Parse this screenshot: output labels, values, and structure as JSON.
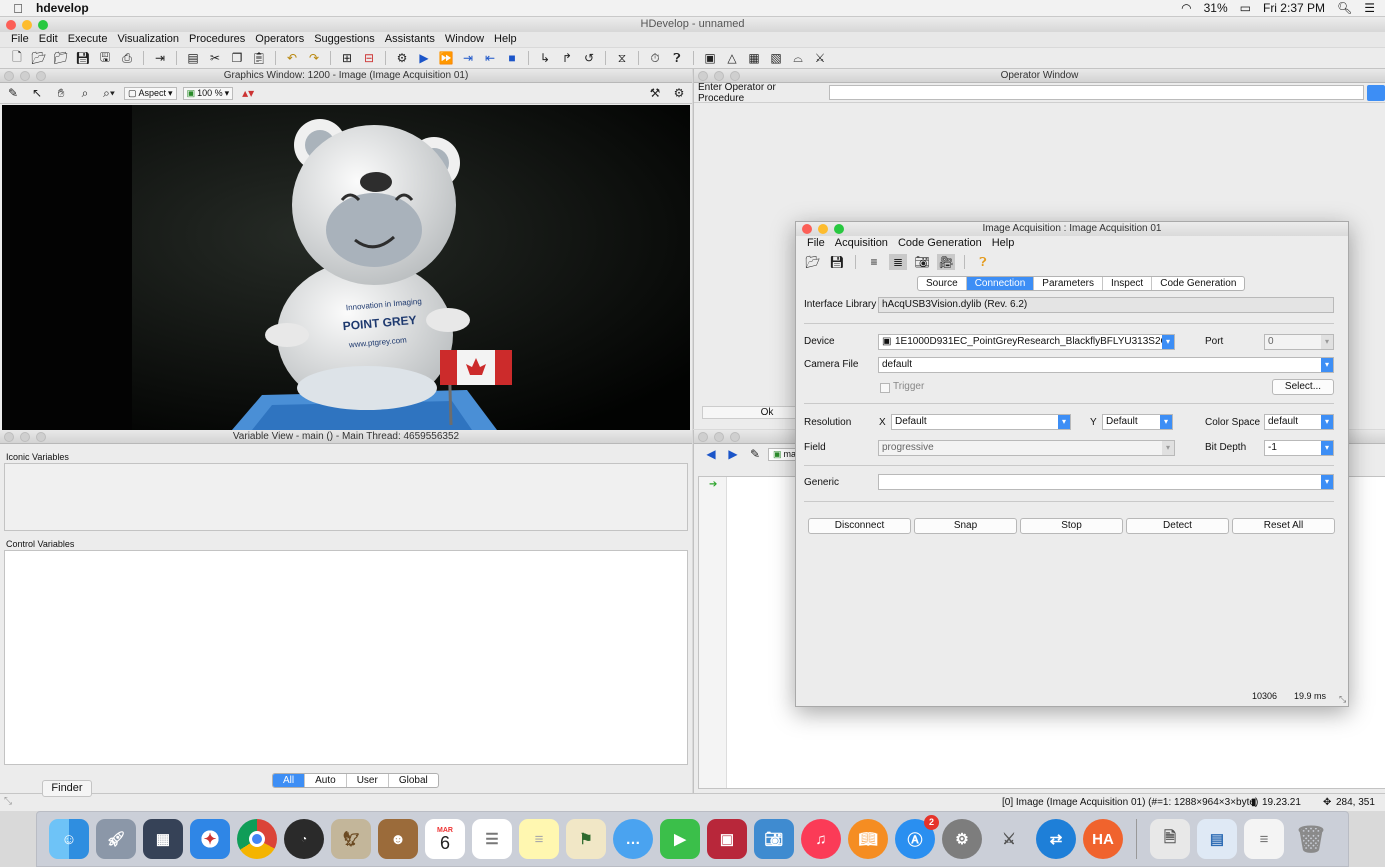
{
  "system_menubar": {
    "app_name": "hdevelop",
    "battery": "31%",
    "clock": "Fri 2:37 PM"
  },
  "app": {
    "title": "HDevelop - unnamed",
    "menu": [
      "File",
      "Edit",
      "Execute",
      "Visualization",
      "Procedures",
      "Operators",
      "Suggestions",
      "Assistants",
      "Window",
      "Help"
    ]
  },
  "graphics_window": {
    "title": "Graphics Window: 1200 - Image (Image Acquisition 01)",
    "aspect_label": "Aspect",
    "zoom_label": "100 %",
    "image_text": {
      "line1": "Innovation in Imaging",
      "brand": "POINT GREY",
      "url": "www.ptgrey.com"
    }
  },
  "operator_window": {
    "title": "Operator Window",
    "prompt_label": "Enter Operator or Procedure",
    "ok_label": "Ok"
  },
  "variable_view": {
    "title": "Variable View - main () - Main Thread: 4659556352",
    "iconic_label": "Iconic Variables",
    "control_label": "Control Variables",
    "filters": [
      "All",
      "Auto",
      "User",
      "Global"
    ]
  },
  "program_window": {
    "procedure": "main"
  },
  "acquisition_dialog": {
    "title": "Image Acquisition : Image Acquisition 01",
    "menu": [
      "File",
      "Acquisition",
      "Code Generation",
      "Help"
    ],
    "tabs": [
      "Source",
      "Connection",
      "Parameters",
      "Inspect",
      "Code Generation"
    ],
    "active_tab": "Connection",
    "interface_library_label": "Interface Library",
    "interface_library_value": "hAcqUSB3Vision.dylib (Rev. 6.2)",
    "device_label": "Device",
    "device_value": "1E1000D931EC_PointGreyResearch_BlackflyBFLYU313S2C",
    "port_label": "Port",
    "port_value": "0",
    "camera_file_label": "Camera File",
    "camera_file_value": "default",
    "trigger_label": "Trigger",
    "select_label": "Select...",
    "resolution_label": "Resolution",
    "x_label": "X",
    "x_value": "Default",
    "y_label": "Y",
    "y_value": "Default",
    "color_space_label": "Color Space",
    "color_space_value": "default",
    "field_label": "Field",
    "field_value": "progressive",
    "bit_depth_label": "Bit Depth",
    "bit_depth_value": "-1",
    "generic_label": "Generic",
    "generic_value": "",
    "buttons": [
      "Disconnect",
      "Snap",
      "Stop",
      "Detect",
      "Reset All"
    ],
    "frame_count": "10306",
    "frame_time": "19.9 ms"
  },
  "status_bar": {
    "image_info": "[0] Image (Image Acquisition 01) (#=1: 1288×964×3×byte)",
    "pixel_value": "19.23.21",
    "coords": "284, 351"
  },
  "dock": {
    "tooltip": "Finder",
    "calendar_month": "MAR",
    "calendar_day": "6",
    "appstore_badge": "2",
    "ha_label": "HA"
  }
}
